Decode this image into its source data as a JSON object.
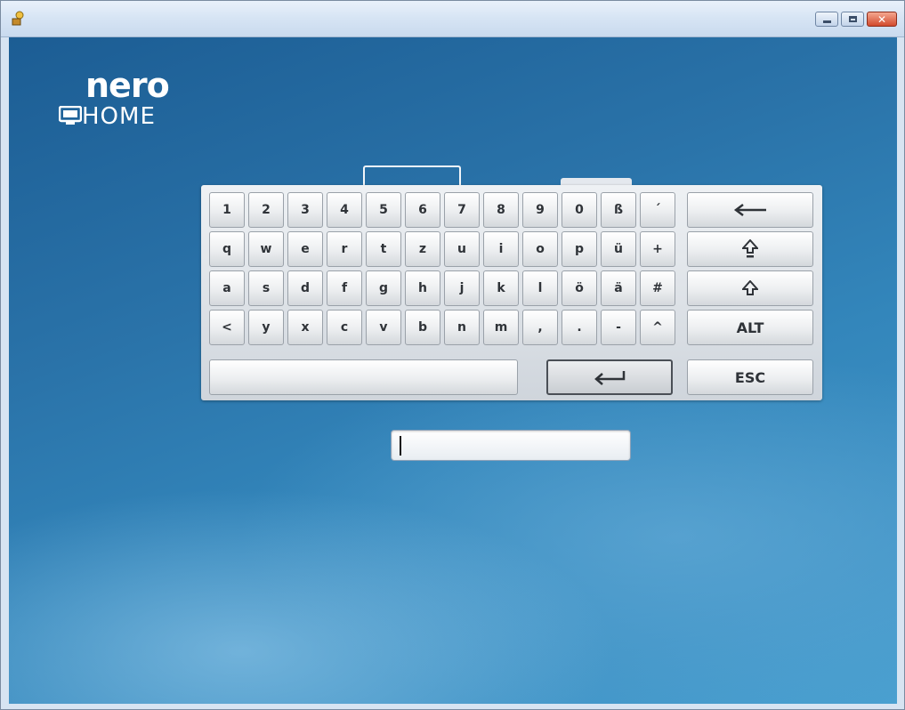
{
  "window": {
    "controls": {
      "minimize": "minimize-icon",
      "maximize": "maximize-icon",
      "close": "close-icon"
    }
  },
  "logo": {
    "brand": "nero",
    "product": "HOME"
  },
  "keyboard": {
    "rows": [
      [
        "1",
        "2",
        "3",
        "4",
        "5",
        "6",
        "7",
        "8",
        "9",
        "0",
        "ß",
        "´"
      ],
      [
        "q",
        "w",
        "e",
        "r",
        "t",
        "z",
        "u",
        "i",
        "o",
        "p",
        "ü",
        "+"
      ],
      [
        "a",
        "s",
        "d",
        "f",
        "g",
        "h",
        "j",
        "k",
        "l",
        "ö",
        "ä",
        "#"
      ],
      [
        "<",
        "y",
        "x",
        "c",
        "v",
        "b",
        "n",
        "m",
        ",",
        ".",
        "-",
        "^"
      ]
    ],
    "side_keys": {
      "backspace": "backspace-arrow-icon",
      "shift_lock": "caps-lock-icon",
      "shift": "shift-icon",
      "alt": "ALT",
      "esc": "ESC"
    },
    "space_key": "",
    "enter_key": "enter-icon"
  },
  "text_field": {
    "value": ""
  },
  "colors": {
    "background_top": "#1c5d94",
    "background_bottom": "#4aa0d0",
    "key_text": "#2f3338"
  }
}
